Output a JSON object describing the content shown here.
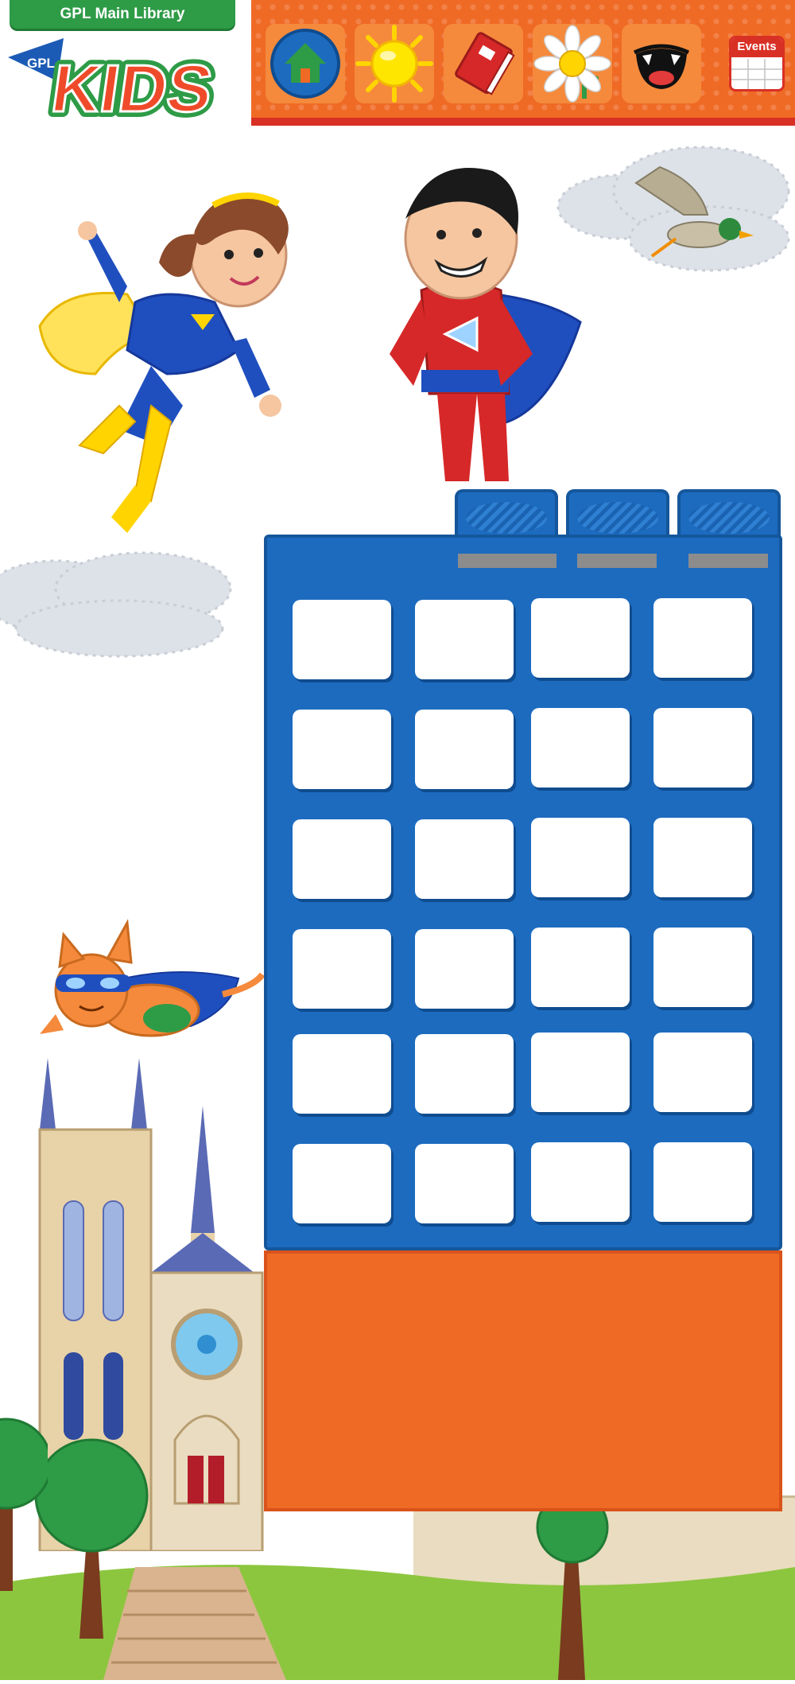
{
  "header": {
    "library_tab_label": "GPL Main Library",
    "logo": {
      "pennant_text": "GPL",
      "word": "KIDS"
    }
  },
  "nav": {
    "items": [
      {
        "name": "home",
        "icon": "house-icon"
      },
      {
        "name": "sun",
        "icon": "sun-icon"
      },
      {
        "name": "book",
        "icon": "book-icon"
      },
      {
        "name": "flower",
        "icon": "flower-icon"
      },
      {
        "name": "face",
        "icon": "grinning-mouth-icon"
      },
      {
        "name": "events",
        "icon": "calendar-icon",
        "label": "Events"
      }
    ]
  },
  "building": {
    "rows": 6,
    "columns": 4
  },
  "colors": {
    "navbar": "#ef6a25",
    "building": "#1c6bbf",
    "panel": "#ef6a25",
    "tab": "#2e9b47",
    "grass": "#8cc63f"
  }
}
